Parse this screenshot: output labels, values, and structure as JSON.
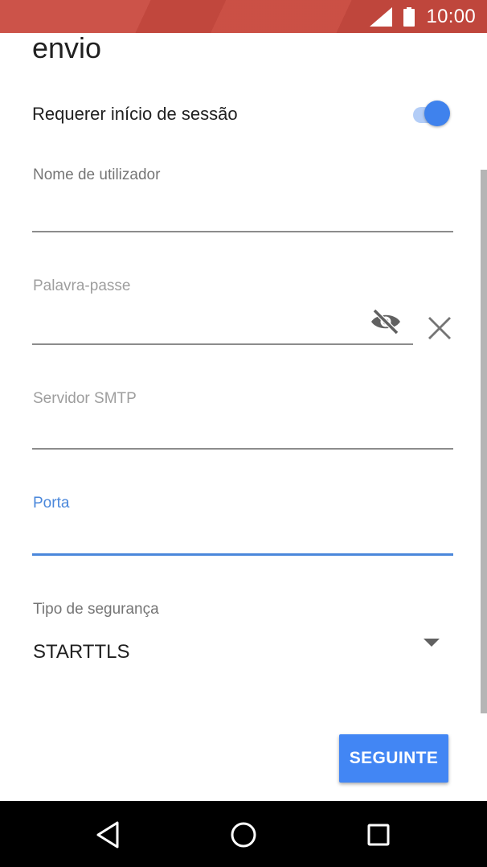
{
  "status_bar": {
    "time": "10:00",
    "icons": [
      "signal-icon",
      "battery-icon"
    ],
    "color": "#c94a3f"
  },
  "page": {
    "title": "envio"
  },
  "toggle": {
    "label": "Requerer início de sessão",
    "checked": true,
    "accent": "#3f82ed"
  },
  "fields": {
    "username": {
      "label": "Nome de utilizador",
      "value": ""
    },
    "password": {
      "label": "Palavra-passe",
      "value": "",
      "icons": [
        "eye-off-icon",
        "close-icon"
      ]
    },
    "smtp": {
      "label": "Servidor SMTP",
      "value": ""
    },
    "port": {
      "label": "Porta",
      "value": "",
      "focused": true
    }
  },
  "security": {
    "label": "Tipo de segurança",
    "value": "STARTTLS"
  },
  "actions": {
    "next_label": "SEGUINTE",
    "color": "#4286f4"
  },
  "nav": {
    "icons": [
      "back-icon",
      "home-icon",
      "recents-icon"
    ]
  }
}
